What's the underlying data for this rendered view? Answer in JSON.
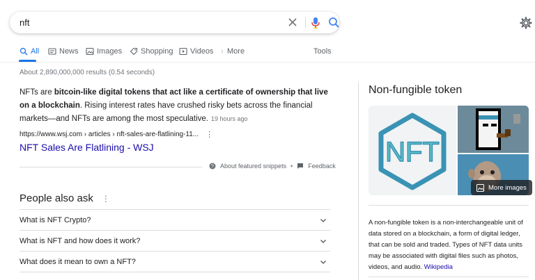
{
  "search": {
    "query": "nft"
  },
  "tabs": [
    {
      "label": "All",
      "icon": "search-icon"
    },
    {
      "label": "News",
      "icon": "news-icon"
    },
    {
      "label": "Images",
      "icon": "image-icon"
    },
    {
      "label": "Shopping",
      "icon": "tag-icon"
    },
    {
      "label": "Videos",
      "icon": "video-icon"
    },
    {
      "label": "More",
      "icon": "kebab-icon"
    }
  ],
  "tools_label": "Tools",
  "result_stats": "About 2,890,000,000 results (0.54 seconds)",
  "featured_snippet": {
    "text_part1": "NFTs are ",
    "text_bold1": "bitcoin-like digital tokens that act like a certificate of ownership that live on a blockchain",
    "text_part2": ". Rising interest rates have crushed risky bets across the financial markets—and NFTs are among the most speculative.",
    "age": "19 hours ago",
    "cite": "https://www.wsj.com › articles › nft-sales-are-flatlining-11...",
    "title": "NFT Sales Are Flatlining - WSJ",
    "about_label": "About featured snippets",
    "separator": "•",
    "feedback_label": "Feedback"
  },
  "people_also_ask": {
    "heading": "People also ask",
    "questions": [
      "What is NFT Crypto?",
      "What is NFT and how does it work?",
      "What does it mean to own a NFT?"
    ]
  },
  "knowledge_panel": {
    "title": "Non-fungible token",
    "logo_text": "NFT",
    "more_images_label": "More images",
    "description": "A non-fungible token is a non-interchangeable unit of data stored on a blockchain, a form of digital ledger, that can be sold and traded. Types of NFT data units may be associated with digital files such as photos, videos, and audio. ",
    "source_link": "Wikipedia"
  },
  "colors": {
    "accent": "#1a73e8",
    "link": "#1a0dab",
    "logo": "#3a93b4"
  }
}
